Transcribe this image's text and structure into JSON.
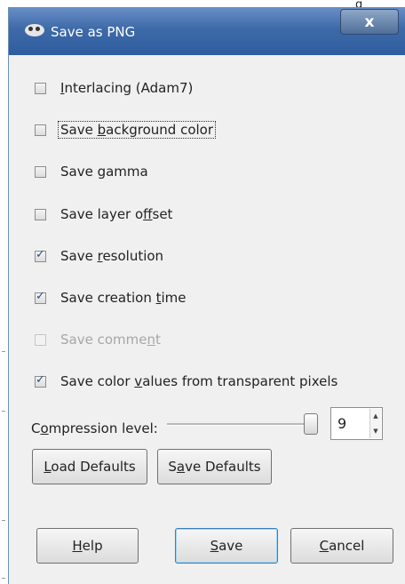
{
  "background": {
    "partial_text": "g"
  },
  "titlebar": {
    "title": "Save as PNG",
    "close_label": "x"
  },
  "options": [
    {
      "pre": "",
      "key": "I",
      "post": "nterlacing (Adam7)",
      "checked": false,
      "enabled": true
    },
    {
      "pre": "Save ",
      "key": "b",
      "post": "ackground color",
      "checked": false,
      "enabled": true
    },
    {
      "pre": "Save gamma",
      "key": "",
      "post": "",
      "checked": false,
      "enabled": true
    },
    {
      "pre": "Save layer o",
      "key": "f",
      "post": "fset",
      "checked": false,
      "enabled": true
    },
    {
      "pre": "Save ",
      "key": "r",
      "post": "esolution",
      "checked": true,
      "enabled": true
    },
    {
      "pre": "Save creation ",
      "key": "t",
      "post": "ime",
      "checked": true,
      "enabled": true
    },
    {
      "pre": "Save comme",
      "key": "n",
      "post": "t",
      "checked": false,
      "enabled": false
    },
    {
      "pre": "Save color ",
      "key": "v",
      "post": "alues from transparent pixels",
      "checked": true,
      "enabled": true
    }
  ],
  "compression": {
    "pre": "C",
    "key": "o",
    "post": "mpression level:",
    "value": "9",
    "min": 0,
    "max": 9
  },
  "defaults_buttons": {
    "load": {
      "pre": "",
      "key": "L",
      "post": "oad Defaults"
    },
    "save": {
      "pre": "S",
      "key": "a",
      "post": "ve Defaults"
    }
  },
  "actions": {
    "help": {
      "pre": "",
      "key": "H",
      "post": "elp"
    },
    "save": {
      "pre": "",
      "key": "S",
      "post": "ave"
    },
    "cancel": {
      "pre": "",
      "key": "C",
      "post": "ancel"
    }
  },
  "colors": {
    "titlebar": "#3e6aa8",
    "dialog_bg": "#f0f0f0",
    "default_button_border": "#3c7fb1"
  }
}
